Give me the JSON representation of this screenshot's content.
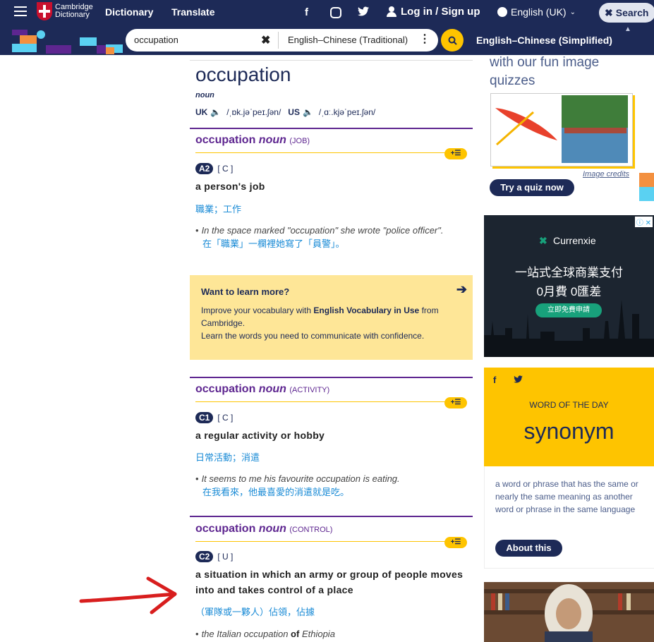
{
  "header": {
    "logo_line1": "Cambridge",
    "logo_line2": "Dictionary",
    "nav": [
      "Dictionary",
      "Translate"
    ],
    "login_label": "Log in / Sign up",
    "language": "English (UK)",
    "search_label": "Search"
  },
  "searchbar": {
    "query": "occupation",
    "dictionary": "English–Chinese (Traditional)",
    "alt_dictionary": "English–Chinese (Simplified)"
  },
  "entry": {
    "headword": "occupation",
    "pos": "noun",
    "uk_label": "UK",
    "uk_ipa": "/ˌɒk.jəˈpeɪ.ʃən/",
    "us_label": "US",
    "us_ipa": "/ˌɑː.kjəˈpeɪ.ʃən/",
    "senses": [
      {
        "word": "occupation",
        "pos": "noun",
        "guide": "(JOB)",
        "level": "A2",
        "grammar": "[ C ]",
        "definition": "a person's job",
        "translation": "職業；工作",
        "example": "In the space marked \"occupation\" she wrote \"police officer\".",
        "example_translation": "在「職業」一欄裡她寫了「員警」。"
      },
      {
        "word": "occupation",
        "pos": "noun",
        "guide": "(ACTIVITY)",
        "level": "C1",
        "grammar": "[ C ]",
        "definition": "a regular activity or hobby",
        "translation": "日常活動；消遣",
        "example": "It seems to me his favourite occupation is eating.",
        "example_translation": "在我看來，他最喜愛的消遣就是吃。"
      },
      {
        "word": "occupation",
        "pos": "noun",
        "guide": "(CONTROL)",
        "level": "C2",
        "grammar": "[ U ]",
        "definition": "a situation in which an army or group of people moves into and takes control of a place",
        "translation": "（軍隊或一夥人）佔領，佔據",
        "example_pre": "the Italian occupation ",
        "example_bold": "of",
        "example_post": " Ethiopia"
      }
    ],
    "learn_more": {
      "title": "Want to learn more?",
      "line1_pre": "Improve your vocabulary with ",
      "line1_bold": "English Vocabulary in Use",
      "line1_post": " from Cambridge.",
      "line2": "Learn the words you need to communicate with confidence."
    }
  },
  "sidebar": {
    "quiz_text": "with our fun image quizzes",
    "image_credits": "Image credits",
    "quiz_button": "Try a quiz now",
    "ad": {
      "brand": "Currenxie",
      "headline1": "一站式全球商業支付",
      "headline2": "0月費 0匯差",
      "cta": "立即免費申請"
    },
    "wotd": {
      "label": "WORD OF THE DAY",
      "word": "synonym",
      "definition": "a word or phrase that has the same or nearly the same meaning as another word or phrase in the same language",
      "button": "About this"
    }
  },
  "colors": {
    "navy": "#1d2a57",
    "purple": "#5e2690",
    "yellow": "#fec400",
    "link_blue": "#1a8bd6",
    "annotation_red": "#d81e1e"
  }
}
